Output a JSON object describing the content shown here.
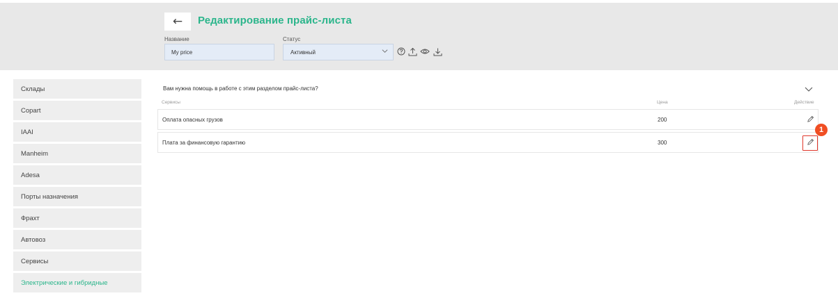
{
  "header": {
    "back_symbol": "←",
    "title": "Редактирование прайс-листа",
    "name_label": "Название",
    "name_value": "My price",
    "status_label": "Статус",
    "status_value": "Активный",
    "toolbar_icons": [
      "help-circle-icon",
      "upload-icon",
      "eye-icon",
      "download-icon"
    ]
  },
  "sidebar": {
    "items": [
      {
        "label": "Склады"
      },
      {
        "label": "Copart"
      },
      {
        "label": "IAAI"
      },
      {
        "label": "Manheim"
      },
      {
        "label": "Adesa"
      },
      {
        "label": "Порты назначения"
      },
      {
        "label": "Фрахт"
      },
      {
        "label": "Автовоз"
      },
      {
        "label": "Сервисы"
      },
      {
        "label": "Электрические и гибридные",
        "active": true
      }
    ]
  },
  "main": {
    "help_text": "Вам нужна помощь в работе с этим разделом прайс-листа?",
    "columns": {
      "service": "Сервисы",
      "price": "Цена",
      "action": "Действие"
    },
    "rows": [
      {
        "name": "Оплата опасных грузов",
        "price": "200"
      },
      {
        "name": "Плата за финансовую гарантию",
        "price": "300"
      }
    ]
  },
  "annotation": {
    "step": "1"
  },
  "colors": {
    "accent": "#2bb58b",
    "highlight": "#e0362a",
    "badge": "#f04e23"
  }
}
